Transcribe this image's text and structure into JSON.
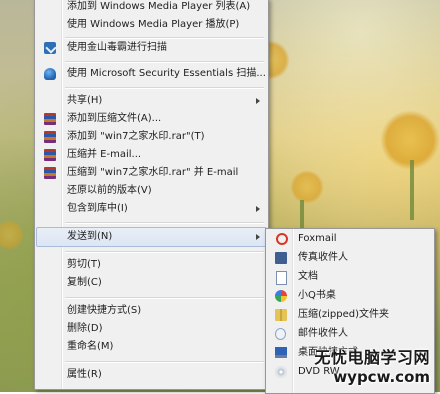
{
  "context_menu": {
    "items": [
      {
        "label": "添加到 Windows Media Player 列表(A)"
      },
      {
        "label": "使用 Windows Media Player 播放(P)"
      },
      {
        "label": "使用金山毒霸进行扫描"
      },
      {
        "label": "使用 Microsoft Security Essentials 扫描..."
      },
      {
        "label": "共享(H)"
      },
      {
        "label": "添加到压缩文件(A)..."
      },
      {
        "label": "添加到 \"win7之家水印.rar\"(T)"
      },
      {
        "label": "压缩并 E-mail..."
      },
      {
        "label": "压缩到 \"win7之家水印.rar\" 并 E-mail"
      },
      {
        "label": "还原以前的版本(V)"
      },
      {
        "label": "包含到库中(I)"
      },
      {
        "label": "发送到(N)"
      },
      {
        "label": "剪切(T)"
      },
      {
        "label": "复制(C)"
      },
      {
        "label": "创建快捷方式(S)"
      },
      {
        "label": "删除(D)"
      },
      {
        "label": "重命名(M)"
      },
      {
        "label": "属性(R)"
      }
    ]
  },
  "send_to_menu": {
    "items": [
      {
        "label": "Foxmail",
        "icon": "foxmail-icon"
      },
      {
        "label": "传真收件人",
        "icon": "fax-icon"
      },
      {
        "label": "文档",
        "icon": "document-icon"
      },
      {
        "label": "小Q书桌",
        "icon": "qq-desk-icon"
      },
      {
        "label": "压缩(zipped)文件夹",
        "icon": "zip-folder-icon"
      },
      {
        "label": "邮件收件人",
        "icon": "mail-recipient-icon"
      },
      {
        "label": "桌面快捷方式",
        "icon": "desktop-icon"
      },
      {
        "label": "DVD RW",
        "icon": "dvd-icon"
      }
    ]
  },
  "watermark": {
    "title": "无忧电脑学习网",
    "url": "wypcw.com"
  }
}
